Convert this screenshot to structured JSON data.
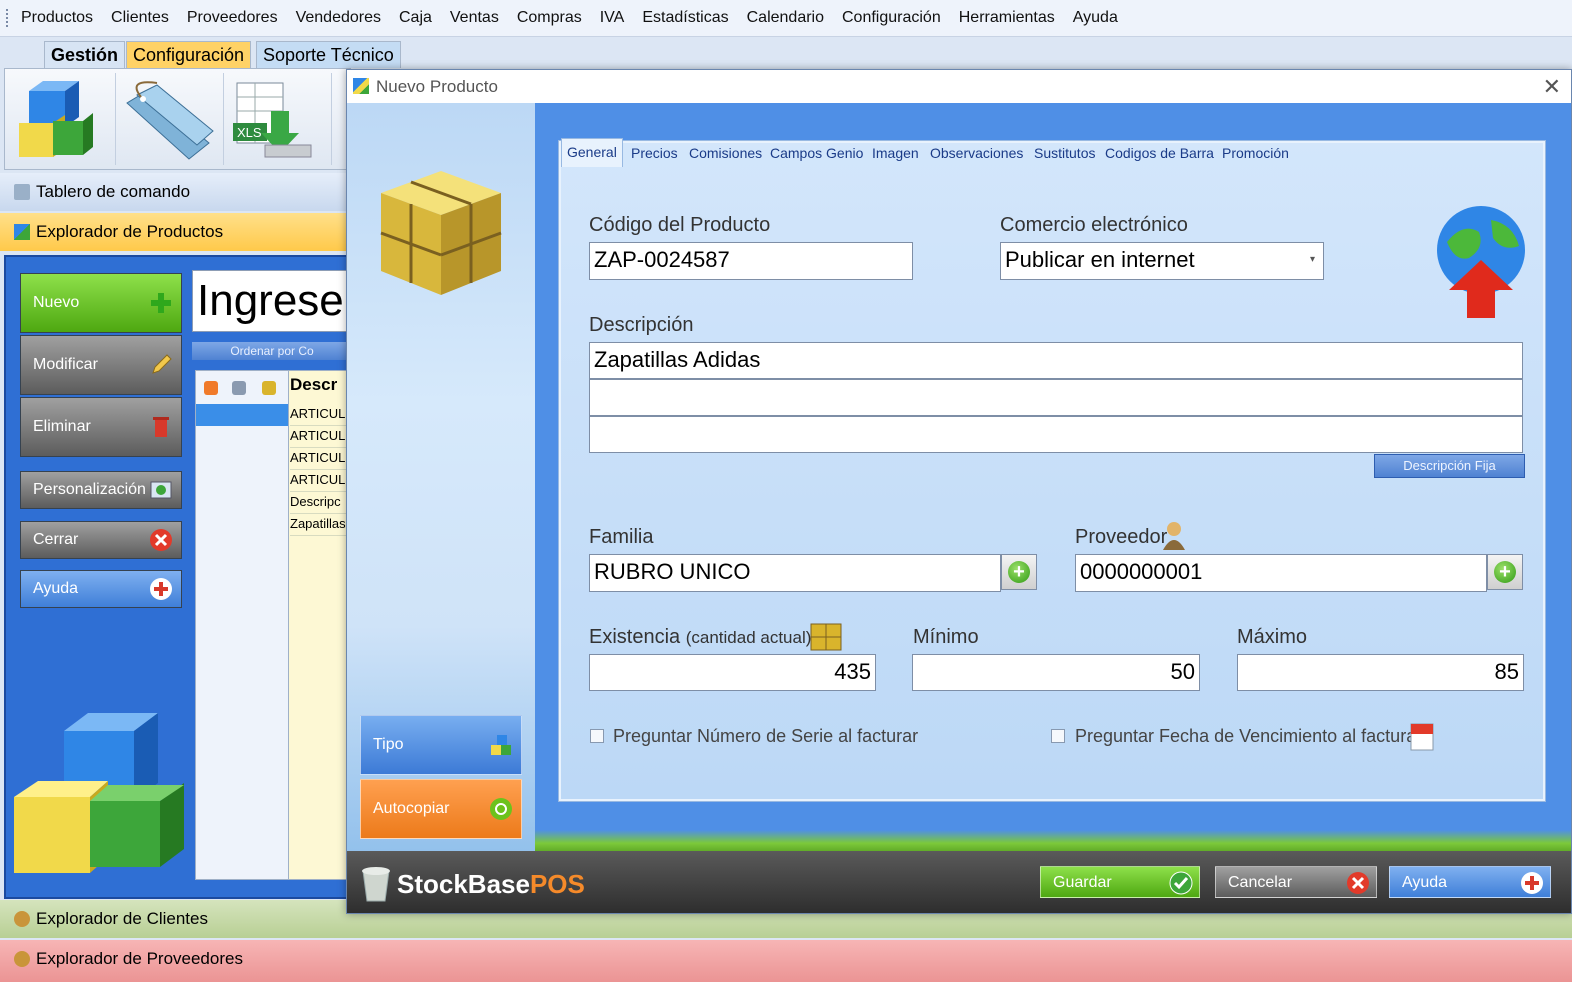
{
  "menu": [
    "Productos",
    "Clientes",
    "Proveedores",
    "Vendedores",
    "Caja",
    "Ventas",
    "Compras",
    "IVA",
    "Estadísticas",
    "Calendario",
    "Configuración",
    "Herramientas",
    "Ayuda"
  ],
  "ribbon_tabs": {
    "gestion": "Gestión",
    "configuracion": "Configuración",
    "soporte": "Soporte Técnico"
  },
  "bars": {
    "tablero": "Tablero de comando",
    "productos": "Explorador de Productos",
    "clientes": "Explorador de Clientes",
    "proveedores": "Explorador de Proveedores"
  },
  "left_buttons": {
    "nuevo": "Nuevo",
    "modificar": "Modificar",
    "eliminar": "Eliminar",
    "personalizacion": "Personalización",
    "cerrar": "Cerrar",
    "ayuda": "Ayuda"
  },
  "search": {
    "text": "Ingrese"
  },
  "sort_label": "Ordenar por Co",
  "grid": {
    "header": "Descr",
    "rows": [
      "ARTICUL",
      "ARTICUL",
      "ARTICUL",
      "ARTICUL",
      "Descripc",
      "Zapatillas"
    ]
  },
  "dialog": {
    "title": "Nuevo Producto",
    "close": "✕",
    "tabs": [
      "General",
      "Precios",
      "Comisiones",
      "Campos Genio",
      "Imagen",
      "Observaciones",
      "Sustitutos",
      "Codigos de Barra",
      "Promoción"
    ],
    "codigo_label": "Código del Producto",
    "codigo_value": "ZAP-0024587",
    "comercio_label": "Comercio electrónico",
    "comercio_value": "Publicar en internet",
    "descripcion_label": "Descripción",
    "descripcion_line1": "Zapatillas Adidas",
    "descripcion_line2": "",
    "descripcion_line3": "",
    "descripcion_fija": "Descripción Fija",
    "familia_label": "Familia",
    "familia_value": "RUBRO UNICO",
    "proveedor_label": "Proveedor",
    "proveedor_value": "0000000001",
    "existencia_label": "Existencia",
    "existencia_sub": "(cantidad actual)",
    "existencia_value": "435",
    "minimo_label": "Mínimo",
    "minimo_value": "50",
    "maximo_label": "Máximo",
    "maximo_value": "85",
    "serie_label": "Preguntar Número de Serie al facturar",
    "vencimiento_label": "Preguntar Fecha de Vencimiento al facturar",
    "tipo": "Tipo",
    "autocopiar": "Autocopiar",
    "brand_a": "StockBase",
    "brand_b": "POS",
    "guardar": "Guardar",
    "cancelar": "Cancelar",
    "ayuda": "Ayuda"
  },
  "colors": {
    "accent": "#4f8fe6",
    "nuevo": "#6cc21c",
    "autocopiar": "#f08a2a",
    "productos_bar": "#ffd266",
    "clientes_bar": "#c7d9a9",
    "proveedores_bar": "#f0a6a6"
  }
}
